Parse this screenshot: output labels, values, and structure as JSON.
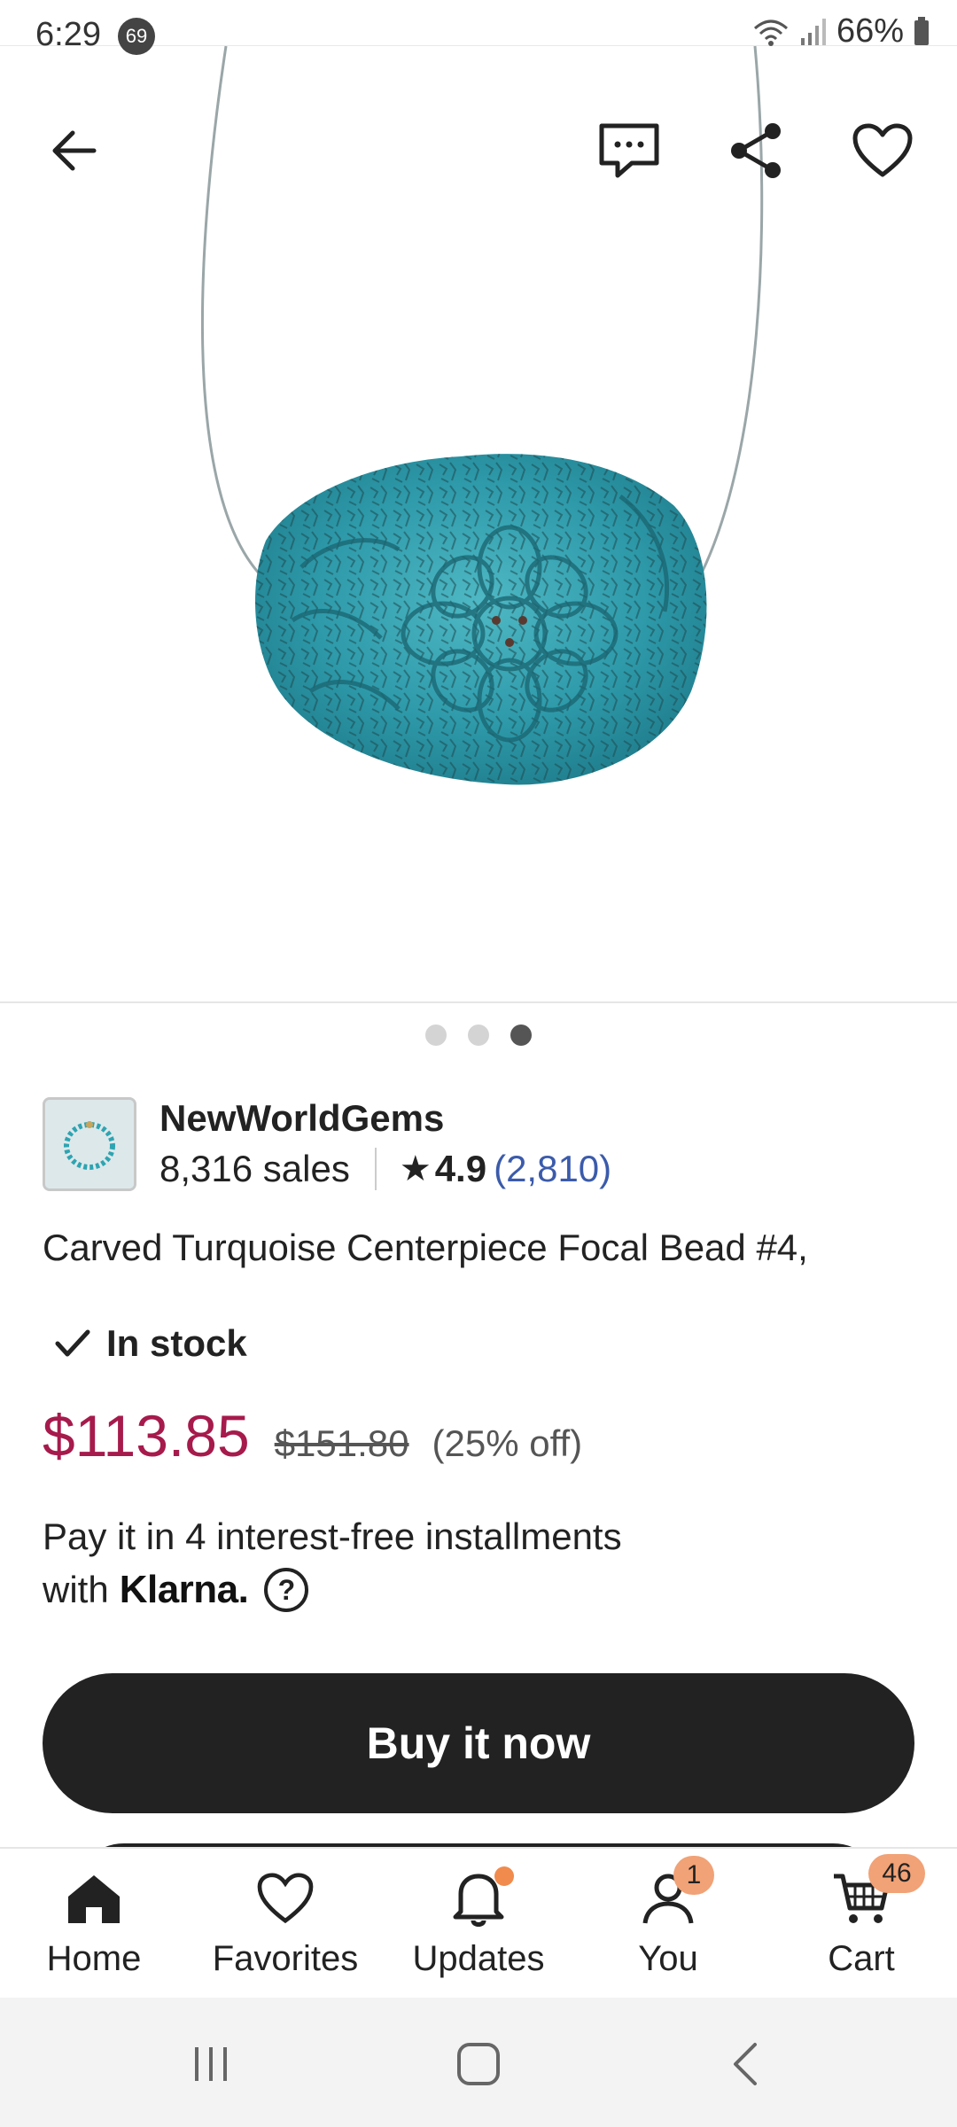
{
  "status_bar": {
    "time": "6:29",
    "notification_count": "69",
    "battery": "66%"
  },
  "top_actions": {
    "back_icon": "arrow-left-icon",
    "message_icon": "message-icon",
    "share_icon": "share-icon",
    "favorite_icon": "heart-icon"
  },
  "carousel": {
    "total": 3,
    "active_index": 2
  },
  "shop": {
    "name": "NewWorldGems",
    "sales": "8,316 sales",
    "rating": "4.9",
    "reviews": "(2,810)"
  },
  "product": {
    "title": "Carved Turquoise Centerpiece Focal Bead #4,",
    "stock": "In stock",
    "price": "$113.85",
    "original_price": "$151.80",
    "discount": "(25% off)"
  },
  "klarna": {
    "line1": "Pay it in 4 interest-free installments",
    "line2_prefix": "with",
    "brand": "Klarna.",
    "help": "?"
  },
  "buy_button": "Buy it now",
  "bottom_nav": {
    "items": [
      {
        "label": "Home",
        "icon": "home-icon"
      },
      {
        "label": "Favorites",
        "icon": "heart-icon"
      },
      {
        "label": "Updates",
        "icon": "bell-icon"
      },
      {
        "label": "You",
        "icon": "person-icon",
        "badge": "1"
      },
      {
        "label": "Cart",
        "icon": "cart-icon",
        "badge": "46"
      }
    ]
  },
  "colors": {
    "price": "#a61a4c",
    "link": "#3b5bab",
    "badge": "#f1a276",
    "button": "#222222"
  }
}
